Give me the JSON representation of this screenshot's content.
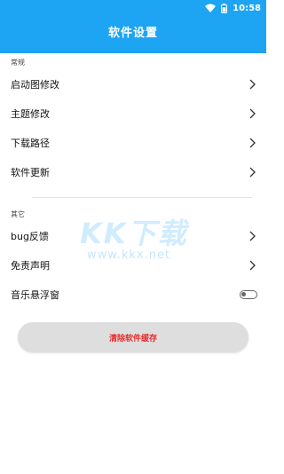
{
  "status_bar": {
    "time": "10:58",
    "battery": "battery-icon",
    "wifi": "wifi-icon"
  },
  "header": {
    "title": "软件设置",
    "color": "#1da4f2"
  },
  "sections": [
    {
      "label": "常规",
      "items": [
        {
          "label": "启动图修改",
          "control": "chevron"
        },
        {
          "label": "主题修改",
          "control": "chevron"
        },
        {
          "label": "下载路径",
          "control": "chevron"
        },
        {
          "label": "软件更新",
          "control": "chevron"
        }
      ]
    },
    {
      "label": "其它",
      "items": [
        {
          "label": "bug反馈",
          "control": "chevron"
        },
        {
          "label": "免责声明",
          "control": "chevron"
        },
        {
          "label": "音乐悬浮窗",
          "control": "toggle",
          "toggle_on": false
        }
      ]
    }
  ],
  "clear_cache_button": {
    "label": "清除软件缓存",
    "text_color": "#e62b2b"
  },
  "watermark": {
    "logo": "KK下载",
    "url": "www.kkx.net"
  }
}
